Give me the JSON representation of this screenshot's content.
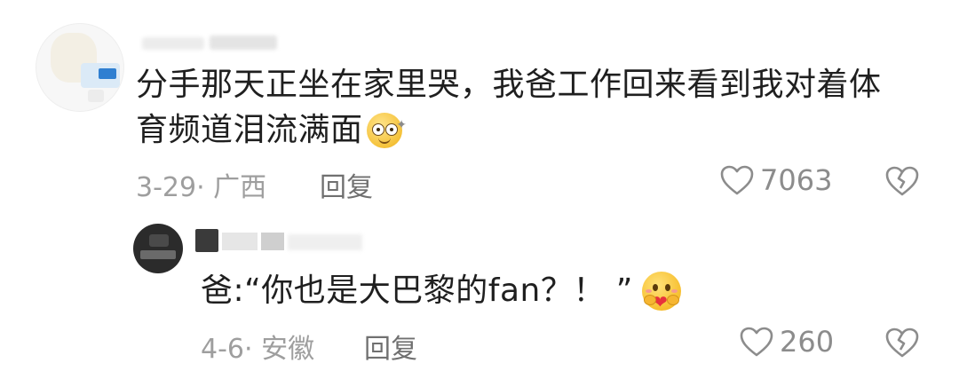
{
  "comments": [
    {
      "text_line1": "分手那天正坐在家里哭，我爸工作回来看到我对着体",
      "text_line2": "育频道泪流满面",
      "date_location": "3-29· 广西",
      "reply_label": "回复",
      "likes": "7063",
      "emoji": "dizzy-smile-emoji"
    },
    {
      "text_line1": "爸:“你也是大巴黎的fan？！ ”",
      "date_location": "4-6· 安徽",
      "reply_label": "回复",
      "likes": "260",
      "emoji": "heart-hug-emoji"
    }
  ],
  "icons": {
    "like": "heart-outline-icon",
    "dislike": "broken-heart-icon"
  },
  "colors": {
    "text": "#1f1f1f",
    "meta": "#9e9e9e",
    "icon": "#8c8c8c"
  }
}
